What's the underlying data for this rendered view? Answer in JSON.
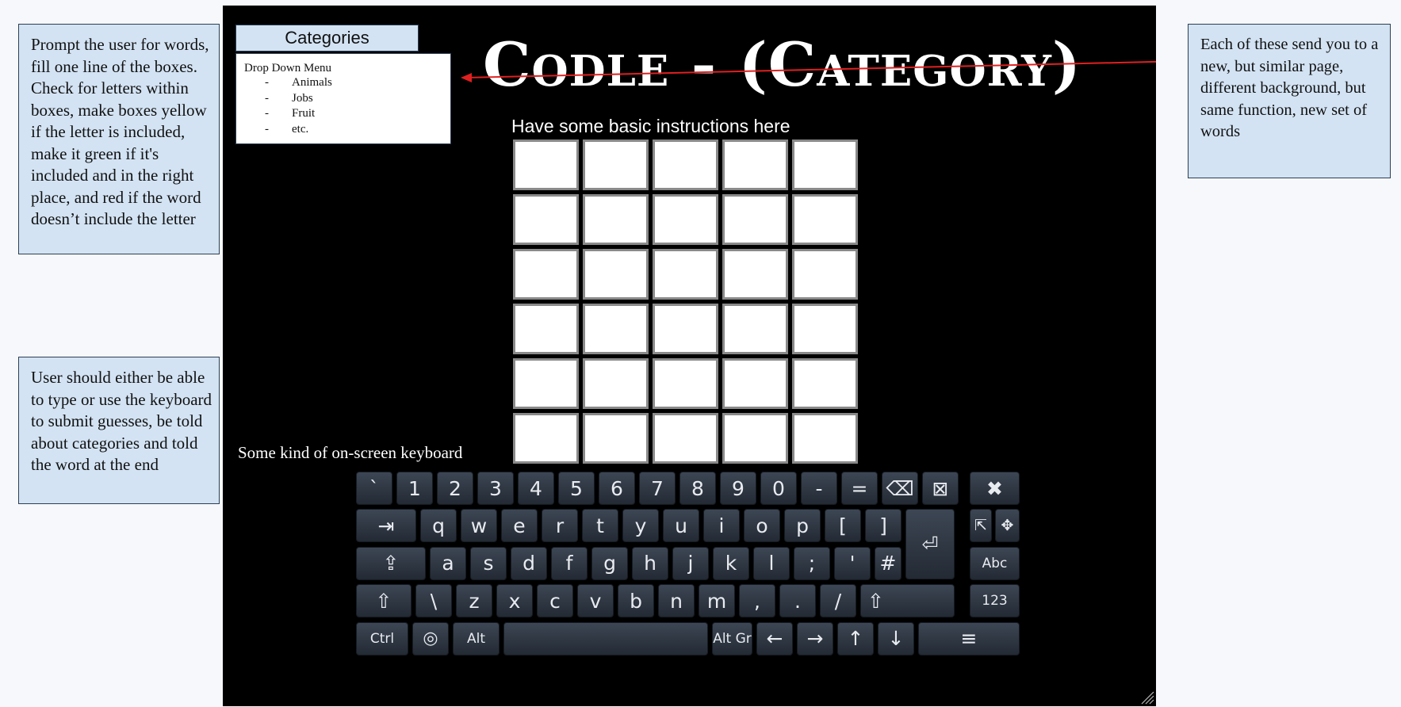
{
  "notes": {
    "left_top": "Prompt the user for words, fill one line of the boxes. Check for letters within boxes, make boxes yellow if the letter is included, make it green if it's included and in the right place, and red if the word doesn’t include the letter",
    "left_bottom": "User should either be able to type or use the keyboard to submit guesses, be told about categories and told the word at the end",
    "right": "Each of these send you to a new, but similar page, different background, but same function, new set of words"
  },
  "categories": {
    "button_label": "Categories",
    "menu_title": "Drop Down Menu",
    "items": [
      "Animals",
      "Jobs",
      "Fruit",
      "etc."
    ],
    "dash": "-"
  },
  "title": "Codle - (Category)",
  "instructions": "Have some basic instructions here",
  "grid": {
    "rows": 6,
    "cols": 5
  },
  "keyboard_label": "Some kind of on-screen keyboard",
  "keyboard": {
    "row1": [
      "`",
      "1",
      "2",
      "3",
      "4",
      "5",
      "6",
      "7",
      "8",
      "9",
      "0",
      "-",
      "=",
      "⌫",
      "⊠",
      "✖"
    ],
    "row2": [
      "⇥",
      "q",
      "w",
      "e",
      "r",
      "t",
      "y",
      "u",
      "i",
      "o",
      "p",
      "[",
      "]",
      "⏎",
      "⇱",
      "✥"
    ],
    "row3": [
      "⇪",
      "a",
      "s",
      "d",
      "f",
      "g",
      "h",
      "j",
      "k",
      "l",
      ";",
      "'",
      "#",
      "Abc"
    ],
    "row4": [
      "⇧",
      "\\",
      "z",
      "x",
      "c",
      "v",
      "b",
      "n",
      "m",
      ",",
      ".",
      "/",
      "⇧",
      "123"
    ],
    "row5": [
      "Ctrl",
      "◎",
      "Alt",
      "",
      "Alt Gr",
      "←",
      "→",
      "↑",
      "↓",
      "≡"
    ]
  },
  "colors": {
    "note_bg": "#d3e3f3",
    "canvas_bg": "#000000",
    "arrow": "#e02020",
    "key_bg": "#2e3540"
  }
}
